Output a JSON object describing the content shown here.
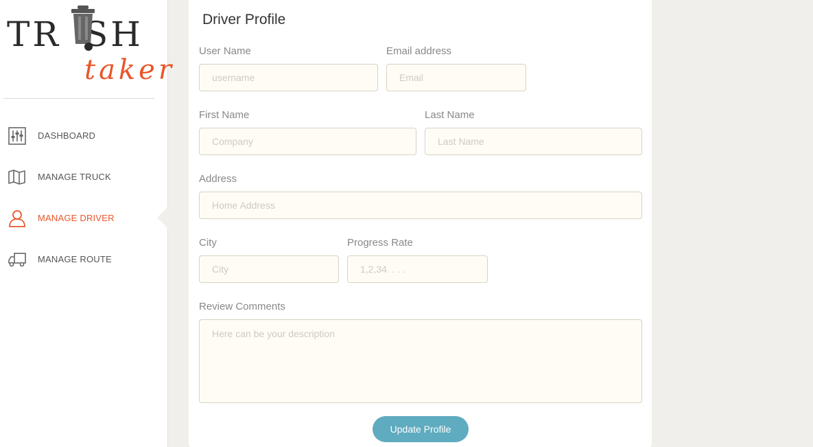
{
  "brand": {
    "word1": "TRASH",
    "word2": "taker",
    "accent_color": "#e8562a"
  },
  "sidebar": {
    "items": [
      {
        "label": "DASHBOARD",
        "icon": "sliders-icon",
        "active": false
      },
      {
        "label": "MANAGE TRUCK",
        "icon": "map-icon",
        "active": false
      },
      {
        "label": "MANAGE DRIVER",
        "icon": "user-icon",
        "active": true
      },
      {
        "label": "MANAGE ROUTE",
        "icon": "truck-icon",
        "active": false
      }
    ]
  },
  "form": {
    "title": "Driver Profile",
    "username": {
      "label": "User Name",
      "placeholder": "username",
      "value": ""
    },
    "email": {
      "label": "Email address",
      "placeholder": "Email",
      "value": ""
    },
    "first_name": {
      "label": "First Name",
      "placeholder": "Company",
      "value": ""
    },
    "last_name": {
      "label": "Last Name",
      "placeholder": "Last Name",
      "value": ""
    },
    "address": {
      "label": "Address",
      "placeholder": "Home Address",
      "value": ""
    },
    "city": {
      "label": "City",
      "placeholder": "City",
      "value": ""
    },
    "progress_rate": {
      "label": "Progress Rate",
      "placeholder": "1,2,34. . . .",
      "value": ""
    },
    "review_comments": {
      "label": "Review Comments",
      "placeholder": "Here can be your description",
      "value": ""
    },
    "submit_label": "Update Profile"
  },
  "colors": {
    "button": "#5fabbf",
    "input_bg": "#fffcf5",
    "active_nav": "#e8562a"
  }
}
